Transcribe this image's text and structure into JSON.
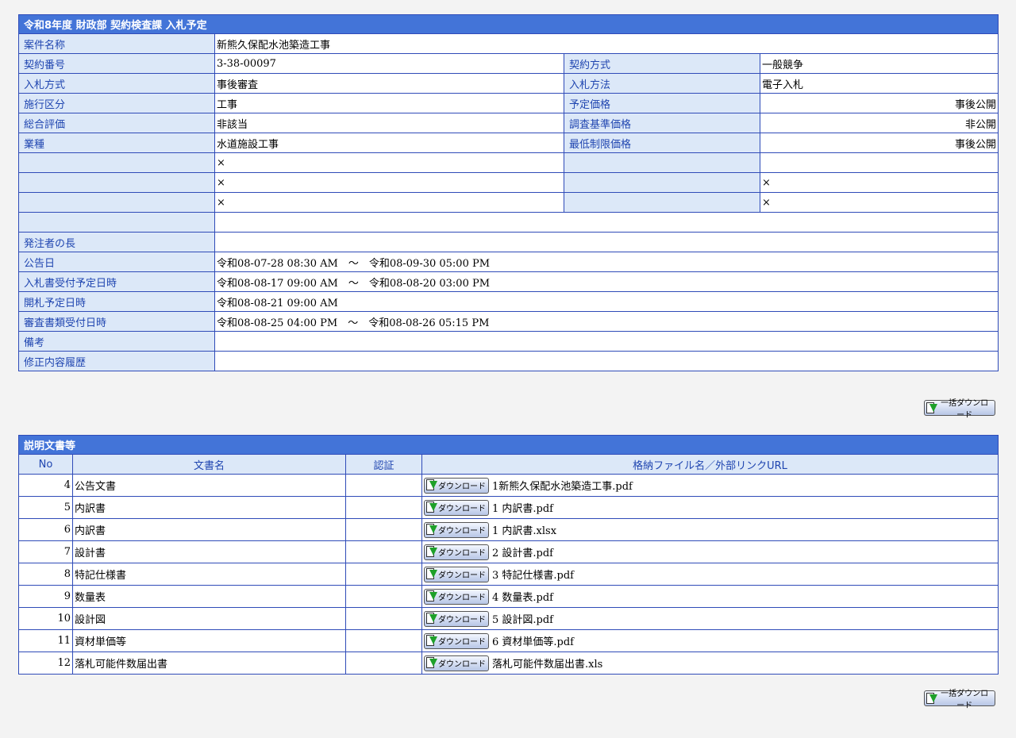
{
  "header_title": "令和8年度 財政部 契約検査課 入札予定",
  "info": {
    "project_name_label": "案件名称",
    "project_name": "新熊久保配水池築造工事",
    "contract_no_label": "契約番号",
    "contract_no": "3-38-00097",
    "contract_method_label": "契約方式",
    "contract_method": "一般競争",
    "bid_type_label": "入札方式",
    "bid_type": "事後審査",
    "bid_method_label": "入札方法",
    "bid_method": "電子入札",
    "construction_class_label": "施行区分",
    "construction_class": "工事",
    "planned_price_label": "予定価格",
    "planned_price": "事後公開",
    "overall_eval_label": "総合評価",
    "overall_eval": "非該当",
    "survey_price_label": "調査基準価格",
    "survey_price": "非公開",
    "industry_label": "業種",
    "industry": "水道施設工事",
    "min_price_label": "最低制限価格",
    "min_price": "事後公開",
    "x_mark": "×",
    "orderer_label": "発注者の長",
    "notice_date_label": "公告日",
    "notice_date": "令和08-07-28 08:30 AM　～　令和08-09-30 05:00 PM",
    "bid_accept_label": "入札書受付予定日時",
    "bid_accept": "令和08-08-17 09:00 AM　～　令和08-08-20 03:00 PM",
    "opening_label": "開札予定日時",
    "opening": "令和08-08-21 09:00 AM",
    "review_docs_label": "審査書類受付日時",
    "review_docs": "令和08-08-25 04:00 PM　～　令和08-08-26 05:15 PM",
    "remarks_label": "備考",
    "revision_label": "修正内容履歴"
  },
  "bulk_download_label": "一括ダウンロード",
  "download_label": "ダウンロード",
  "docs": {
    "title": "説明文書等",
    "col_no": "No",
    "col_name": "文書名",
    "col_cert": "認証",
    "col_file": "格納ファイル名／外部リンクURL",
    "rows": [
      {
        "no": "4",
        "name": "公告文書",
        "file": "1新熊久保配水池築造工事.pdf"
      },
      {
        "no": "5",
        "name": "内訳書",
        "file": "1 内訳書.pdf"
      },
      {
        "no": "6",
        "name": "内訳書",
        "file": "1 内訳書.xlsx"
      },
      {
        "no": "7",
        "name": "設計書",
        "file": "2 設計書.pdf"
      },
      {
        "no": "8",
        "name": "特記仕様書",
        "file": "3 特記仕様書.pdf"
      },
      {
        "no": "9",
        "name": "数量表",
        "file": "4 数量表.pdf"
      },
      {
        "no": "10",
        "name": "設計図",
        "file": "5 設計図.pdf"
      },
      {
        "no": "11",
        "name": "資材単価等",
        "file": "6 資材単価等.pdf"
      },
      {
        "no": "12",
        "name": "落札可能件数届出書",
        "file": "落札可能件数届出書.xls"
      }
    ]
  }
}
